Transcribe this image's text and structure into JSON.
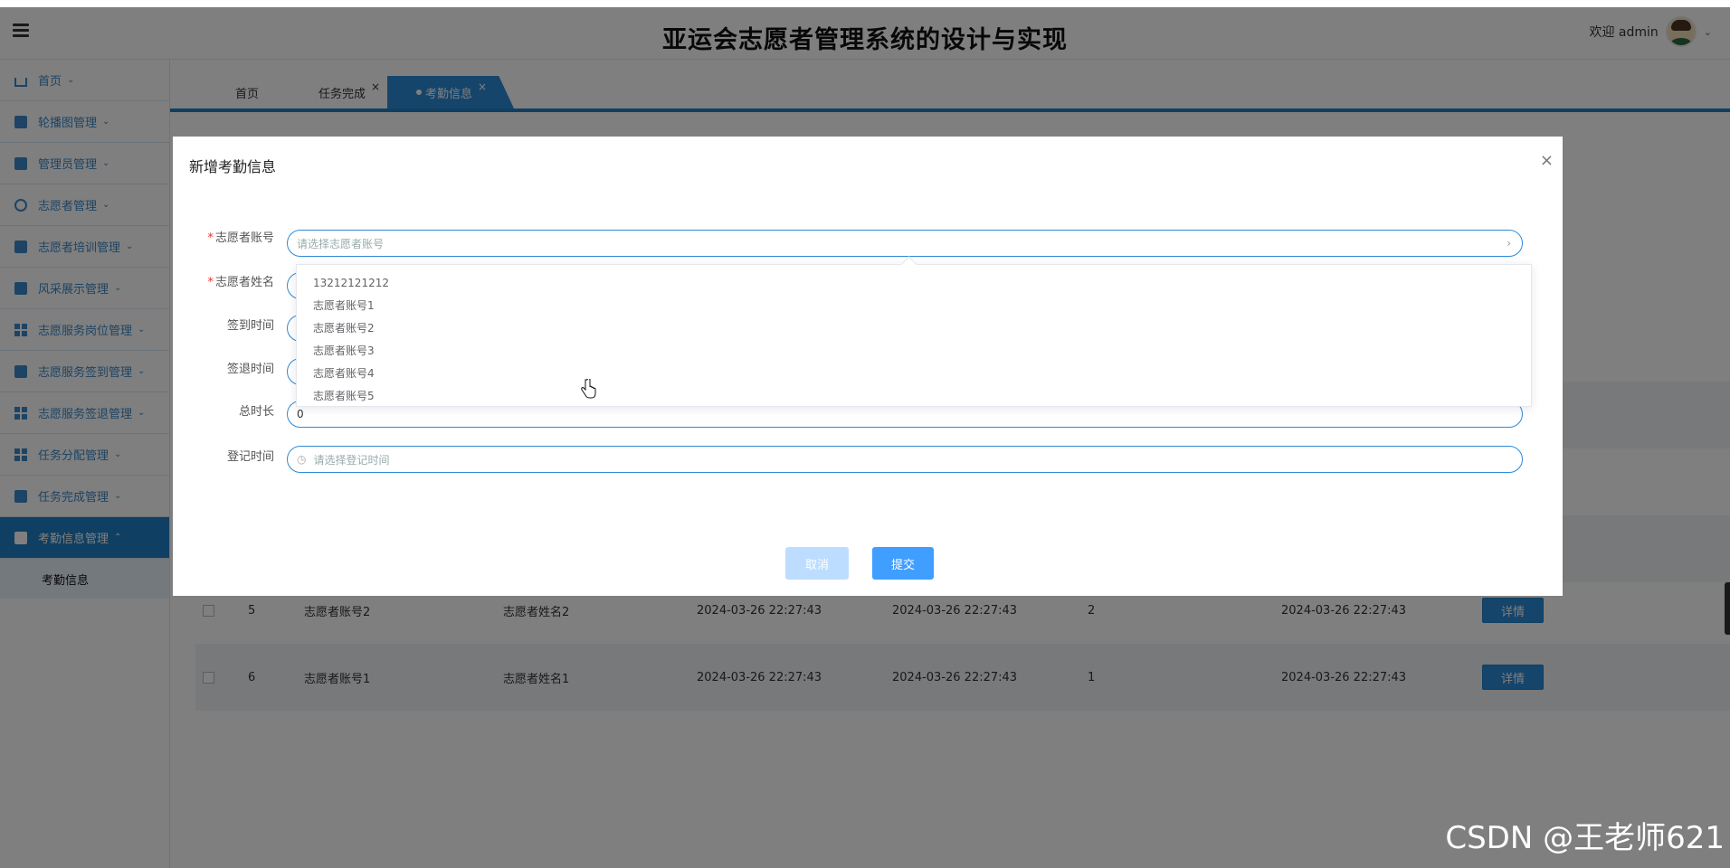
{
  "header": {
    "title": "亚运会志愿者管理系统的设计与实现",
    "welcome": "欢迎 admin"
  },
  "sidebar": {
    "items": [
      {
        "label": "首页"
      },
      {
        "label": "轮播图管理"
      },
      {
        "label": "管理员管理"
      },
      {
        "label": "志愿者管理"
      },
      {
        "label": "志愿者培训管理"
      },
      {
        "label": "风采展示管理"
      },
      {
        "label": "志愿服务岗位管理"
      },
      {
        "label": "志愿服务签到管理"
      },
      {
        "label": "志愿服务签退管理"
      },
      {
        "label": "任务分配管理"
      },
      {
        "label": "任务完成管理"
      },
      {
        "label": "考勤信息管理"
      }
    ],
    "active_submenu": "考勤信息"
  },
  "tabs": [
    {
      "label": "首页"
    },
    {
      "label": "任务完成"
    },
    {
      "label": "考勤信息"
    }
  ],
  "table": {
    "detail_label": "详情",
    "rows": [
      {
        "id": "5",
        "account": "志愿者账号2",
        "name": "志愿者姓名2",
        "signin": "2024-03-26 22:27:43",
        "signout": "2024-03-26 22:27:43",
        "total": "2",
        "registered": "2024-03-26 22:27:43"
      },
      {
        "id": "6",
        "account": "志愿者账号1",
        "name": "志愿者姓名1",
        "signin": "2024-03-26 22:27:43",
        "signout": "2024-03-26 22:27:43",
        "total": "1",
        "registered": "2024-03-26 22:27:43"
      }
    ]
  },
  "dialog": {
    "title": "新增考勤信息",
    "fields": {
      "account_label": "志愿者账号",
      "account_placeholder": "请选择志愿者账号",
      "name_label": "志愿者姓名",
      "signin_label": "签到时间",
      "signout_label": "签退时间",
      "total_label": "总时长",
      "total_value": "0",
      "register_label": "登记时间",
      "register_placeholder": "请选择登记时间"
    },
    "dropdown_options": [
      "13212121212",
      "志愿者账号1",
      "志愿者账号2",
      "志愿者账号3",
      "志愿者账号4",
      "志愿者账号5"
    ],
    "cancel_label": "取消",
    "submit_label": "提交"
  },
  "watermark": "CSDN @王老师621"
}
